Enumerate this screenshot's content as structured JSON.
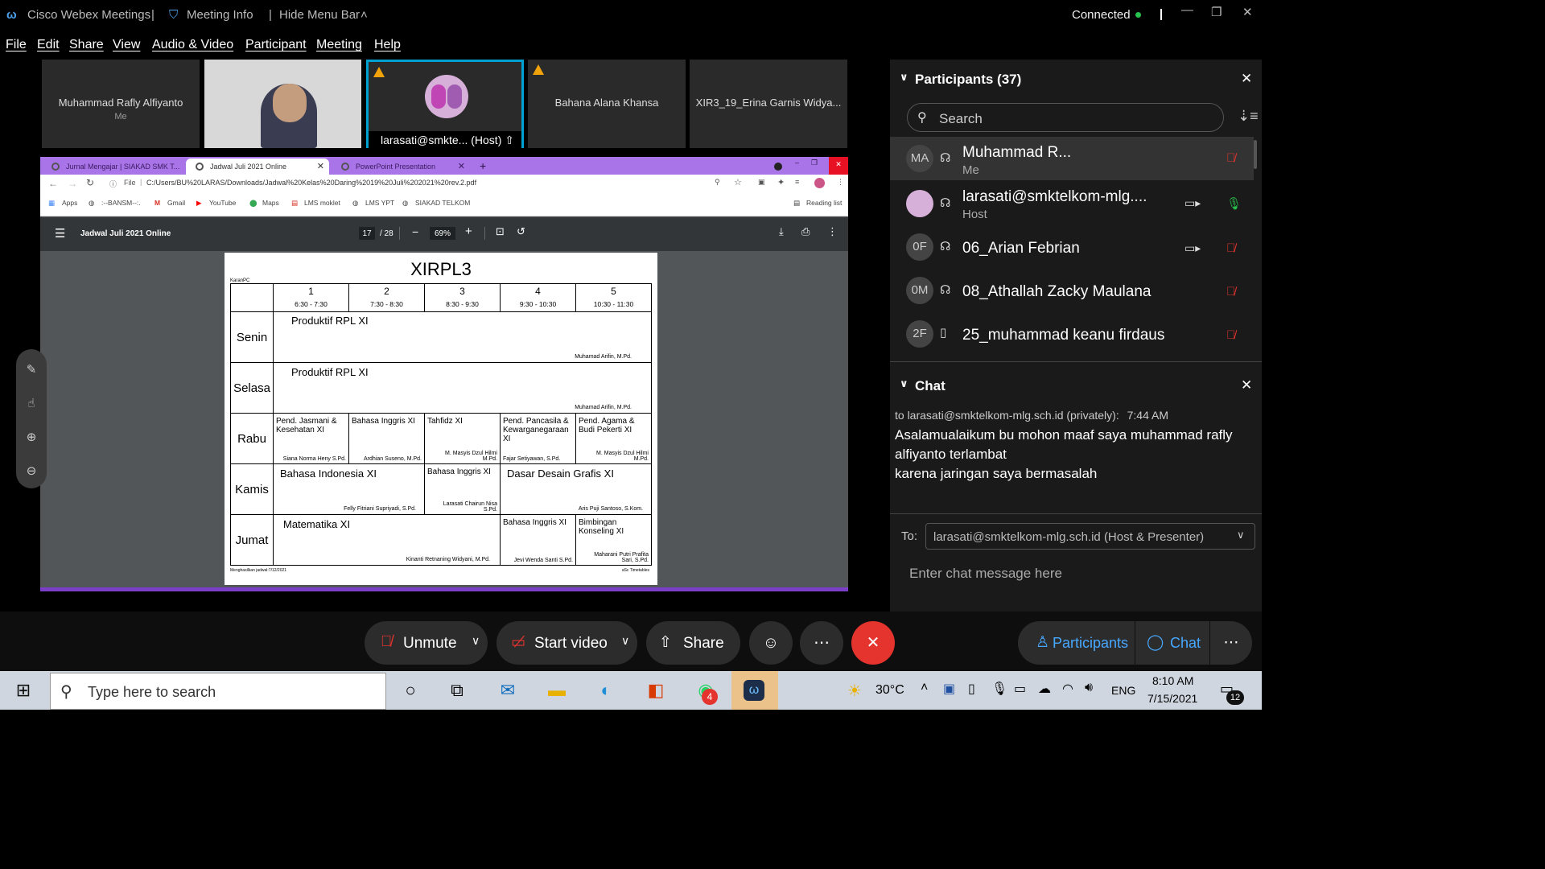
{
  "titlebar": {
    "app_title": "Cisco Webex Meetings",
    "meeting_info": "Meeting Info",
    "hide_menu": "Hide Menu Bar",
    "status": "Connected"
  },
  "menu": [
    "File",
    "Edit",
    "Share",
    "View",
    "Audio & Video",
    "Participant",
    "Meeting",
    "Help"
  ],
  "tiles": [
    {
      "name": "Muhammad Rafly Alfiyanto",
      "sub": "Me"
    },
    {
      "name": "",
      "sub": ""
    },
    {
      "name": "larasati@smkte...",
      "sub": "(Host)"
    },
    {
      "name": "Bahana Alana Khansa",
      "sub": ""
    },
    {
      "name": "XIR3_19_Erina Garnis Widya...",
      "sub": ""
    }
  ],
  "browser": {
    "tabs": [
      "Jurnal Mengajar | SIAKAD SMK T...",
      "Jadwal Juli 2021 Online",
      "PowerPoint Presentation"
    ],
    "url_prefix": "File",
    "url": "C:/Users/BU%20LARAS/Downloads/Jadwal%20Kelas%20Daring%2019%20Juli%202021%20rev.2.pdf",
    "bookmarks": [
      "Apps",
      ":--BANSM--:.",
      "Gmail",
      "YouTube",
      "Maps",
      "LMS moklet",
      "LMS YPT",
      "SIAKAD TELKOM"
    ],
    "reading_list": "Reading list"
  },
  "pdf": {
    "title": "Jadwal Juli 2021 Online",
    "page": "17",
    "pages": "/ 28",
    "zoom": "69%",
    "doc_title": "XIRPL3",
    "corner_label": "KaranPC",
    "footer_left": "Menghasilkan jadwal:7/12/2021",
    "footer_right": "aSc Timetables",
    "periods": [
      {
        "num": "1",
        "time": "6:30 - 7:30"
      },
      {
        "num": "2",
        "time": "7:30 - 8:30"
      },
      {
        "num": "3",
        "time": "8:30 - 9:30"
      },
      {
        "num": "4",
        "time": "9:30 - 10:30"
      },
      {
        "num": "5",
        "time": "10:30 - 11:30"
      }
    ],
    "days": [
      "Senin",
      "Selasa",
      "Rabu",
      "Kamis",
      "Jumat"
    ],
    "cells": {
      "senin": {
        "subject": "Produktif RPL XI",
        "teacher": "Muhamad Arifin, M.Pd."
      },
      "selasa": {
        "subject": "Produktif RPL XI",
        "teacher": "Muhamad Arifin, M.Pd."
      },
      "rabu": [
        {
          "subject": "Pend. Jasmani & Kesehatan XI",
          "teacher": "Siana Norma Heny S.Pd."
        },
        {
          "subject": "Bahasa Inggris XI",
          "teacher": "Ardhian Suseno, M.Pd."
        },
        {
          "subject": "Tahfidz XI",
          "teacher": "M. Masyis Dzul Hilmi M.Pd."
        },
        {
          "subject": "Pend. Pancasila & Kewarganegaraan XI",
          "teacher": "Fajar Setiyawan, S.Pd."
        },
        {
          "subject": "Pend. Agama & Budi Pekerti XI",
          "teacher": "M. Masyis Dzul Hilmi M.Pd."
        }
      ],
      "kamis": [
        {
          "subject": "Bahasa Indonesia XI",
          "teacher": "Felly Fitriani Supriyadi, S.Pd."
        },
        {
          "subject": "Bahasa Inggris XI",
          "teacher": "Larasati Chairun Nisa S.Pd."
        },
        {
          "subject": "Dasar Desain Grafis XI",
          "teacher": "Aris Puji Santoso, S.Kom."
        }
      ],
      "jumat": [
        {
          "subject": "Matematika XI",
          "teacher": "Kinanti Retnaning Widyani, M.Pd."
        },
        {
          "subject": "Bahasa Inggris XI",
          "teacher": "Jevi Wenda Santi S.Pd."
        },
        {
          "subject": "Bimbingan Konseling XI",
          "teacher": "Maharani Putri Prafita Sari, S.Pd."
        }
      ]
    }
  },
  "participants_panel": {
    "title": "Participants (37)",
    "search_placeholder": "Search",
    "list": [
      {
        "initials": "MA",
        "name": "Muhammad R...",
        "role": "Me"
      },
      {
        "initials": "",
        "name": "larasati@smktelkom-mlg....",
        "role": "Host"
      },
      {
        "initials": "0F",
        "name": "06_Arian Febrian",
        "role": ""
      },
      {
        "initials": "0M",
        "name": "08_Athallah Zacky Maulana",
        "role": ""
      },
      {
        "initials": "2F",
        "name": "25_muhammad keanu firdaus",
        "role": ""
      }
    ]
  },
  "chat_panel": {
    "title": "Chat",
    "meta": "to larasati@smktelkom-mlg.sch.id (privately):",
    "time": "7:44 AM",
    "lines": [
      "Asalamualaikum bu mohon maaf saya muhammad rafly",
      "alfiyanto terlambat",
      "karena jaringan saya bermasalah"
    ],
    "to_label": "To:",
    "to_value": "larasati@smktelkom-mlg.sch.id (Host & Presenter)",
    "input_placeholder": "Enter chat message here"
  },
  "controls": {
    "unmute": "Unmute",
    "start_video": "Start video",
    "share": "Share",
    "participants": "Participants",
    "chat": "Chat"
  },
  "taskbar": {
    "search_placeholder": "Type here to search",
    "weather": "30°C",
    "lang": "ENG",
    "time": "8:10 AM",
    "date": "7/15/2021",
    "notif_count": "12",
    "whatsapp_badge": "4"
  },
  "colors": {
    "accent": "#47a8ff",
    "danger": "#e5342e",
    "tabbar": "#a874e8",
    "selected_tile": "#00a0d1"
  }
}
